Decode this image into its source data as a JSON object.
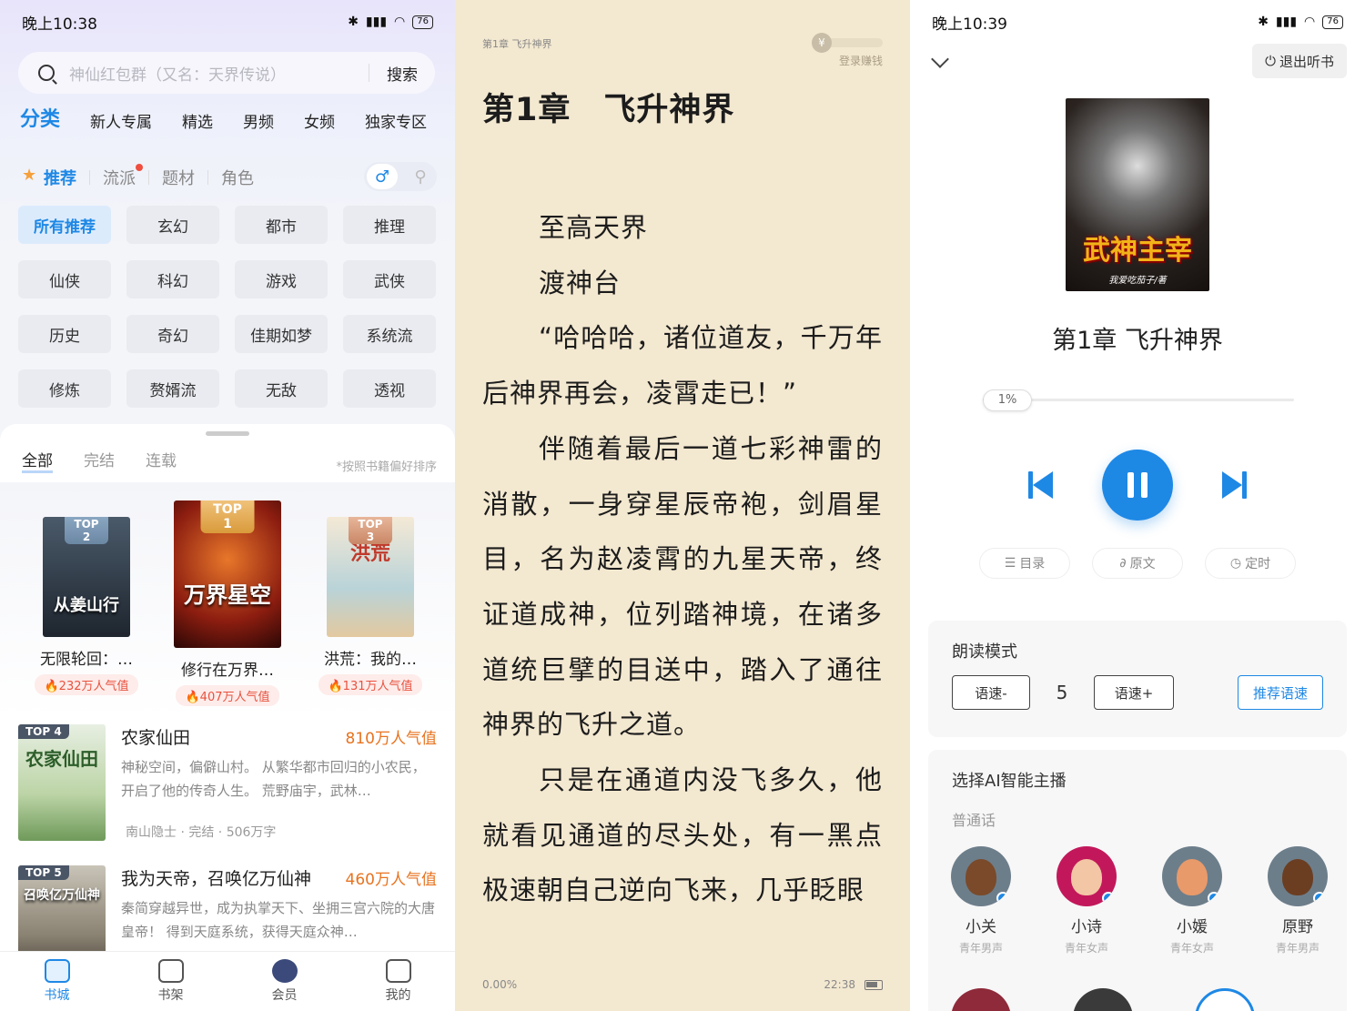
{
  "colors": {
    "accent": "#1e88e5",
    "heat": "#e8523f",
    "reader_bg": "#f3e8d0"
  },
  "bookstore": {
    "status": {
      "time": "晚上10:38",
      "battery": "76"
    },
    "search": {
      "placeholder": "神仙红包群（又名：天界传说）",
      "button": "搜索"
    },
    "nav": [
      "分类",
      "新人专属",
      "精选",
      "男频",
      "女频",
      "独家专区"
    ],
    "subtabs": [
      "推荐",
      "流派",
      "题材",
      "角色"
    ],
    "gender": {
      "male_icon": "male-icon",
      "female_icon": "female-icon"
    },
    "tags": [
      "所有推荐",
      "玄幻",
      "都市",
      "推理",
      "仙侠",
      "科幻",
      "游戏",
      "武侠",
      "历史",
      "奇幻",
      "佳期如梦",
      "系统流",
      "修炼",
      "赘婿流",
      "无敌",
      "透视"
    ],
    "rank_tabs": [
      "全部",
      "完结",
      "连载"
    ],
    "sort_note": "*按照书籍偏好排序",
    "top3": [
      {
        "rank": "TOP 2",
        "title": "无限轮回：…",
        "heat": "232万人气值",
        "cover_text": "从姜山行"
      },
      {
        "rank": "TOP 1",
        "title": "修行在万界…",
        "heat": "407万人气值",
        "cover_text": "万界星空"
      },
      {
        "rank": "TOP 3",
        "title": "洪荒：我的…",
        "heat": "131万人气值",
        "cover_text": "洪荒"
      }
    ],
    "list": [
      {
        "rank": "TOP 4",
        "title": "农家仙田",
        "heat": "810万人气值",
        "desc": "神秘空间，偏僻山村。 从繁华都市回归的小农民，开启了他的传奇人生。 荒野庙宇，武林…",
        "meta": "南山隐士 · 完结 · 506万字",
        "cover_text": "农家仙田"
      },
      {
        "rank": "TOP 5",
        "title": "我为天帝，召唤亿万仙神",
        "heat": "460万人气值",
        "desc": "秦简穿越异世，成为执掌天下、坐拥三宫六院的大唐皇帝！ 得到天庭系统，获得天庭众神…",
        "meta": "",
        "cover_text": "召唤亿万仙神"
      }
    ],
    "bottom_nav": [
      "书城",
      "书架",
      "会员",
      "我的"
    ]
  },
  "reader": {
    "header_chapter": "第1章 飞升神界",
    "coin_text": "登录赚钱",
    "title": "第1章　飞升神界",
    "paragraphs": [
      "至高天界",
      "渡神台",
      "“哈哈哈，诸位道友，千万年后神界再会，凌霄走已！”",
      "伴随着最后一道七彩神雷的消散，一身穿星辰帝袍，剑眉星目，名为赵凌霄的九星天帝，终证道成神，位列踏神境，在诸多道统巨擘的目送中，踏入了通往神界的飞升之道。",
      "只是在通道内没飞多久，他就看见通道的尽头处，有一黑点极速朝自己逆向飞来，几乎眨眼"
    ],
    "progress": "0.00%",
    "time": "22:38"
  },
  "listen": {
    "status": {
      "time": "晚上10:39",
      "battery": "76"
    },
    "exit": "退出听书",
    "cover_title": "武神主宰",
    "cover_author": "我爱吃茄子/著",
    "chapter": "第1章 飞升神界",
    "progress_label": "1%",
    "progress": 0.01,
    "sub_controls": [
      "目录",
      "原文",
      "定时"
    ],
    "mode": {
      "title": "朗读模式",
      "slower": "语速-",
      "speed": "5",
      "faster": "语速+",
      "recommend": "推荐语速"
    },
    "voices_title": "选择AI智能主播",
    "voices_sub": "普通话",
    "voices": [
      {
        "name": "小关",
        "desc": "青年男声"
      },
      {
        "name": "小诗",
        "desc": "青年女声"
      },
      {
        "name": "小媛",
        "desc": "青年女声"
      },
      {
        "name": "原野",
        "desc": "青年男声"
      }
    ]
  }
}
